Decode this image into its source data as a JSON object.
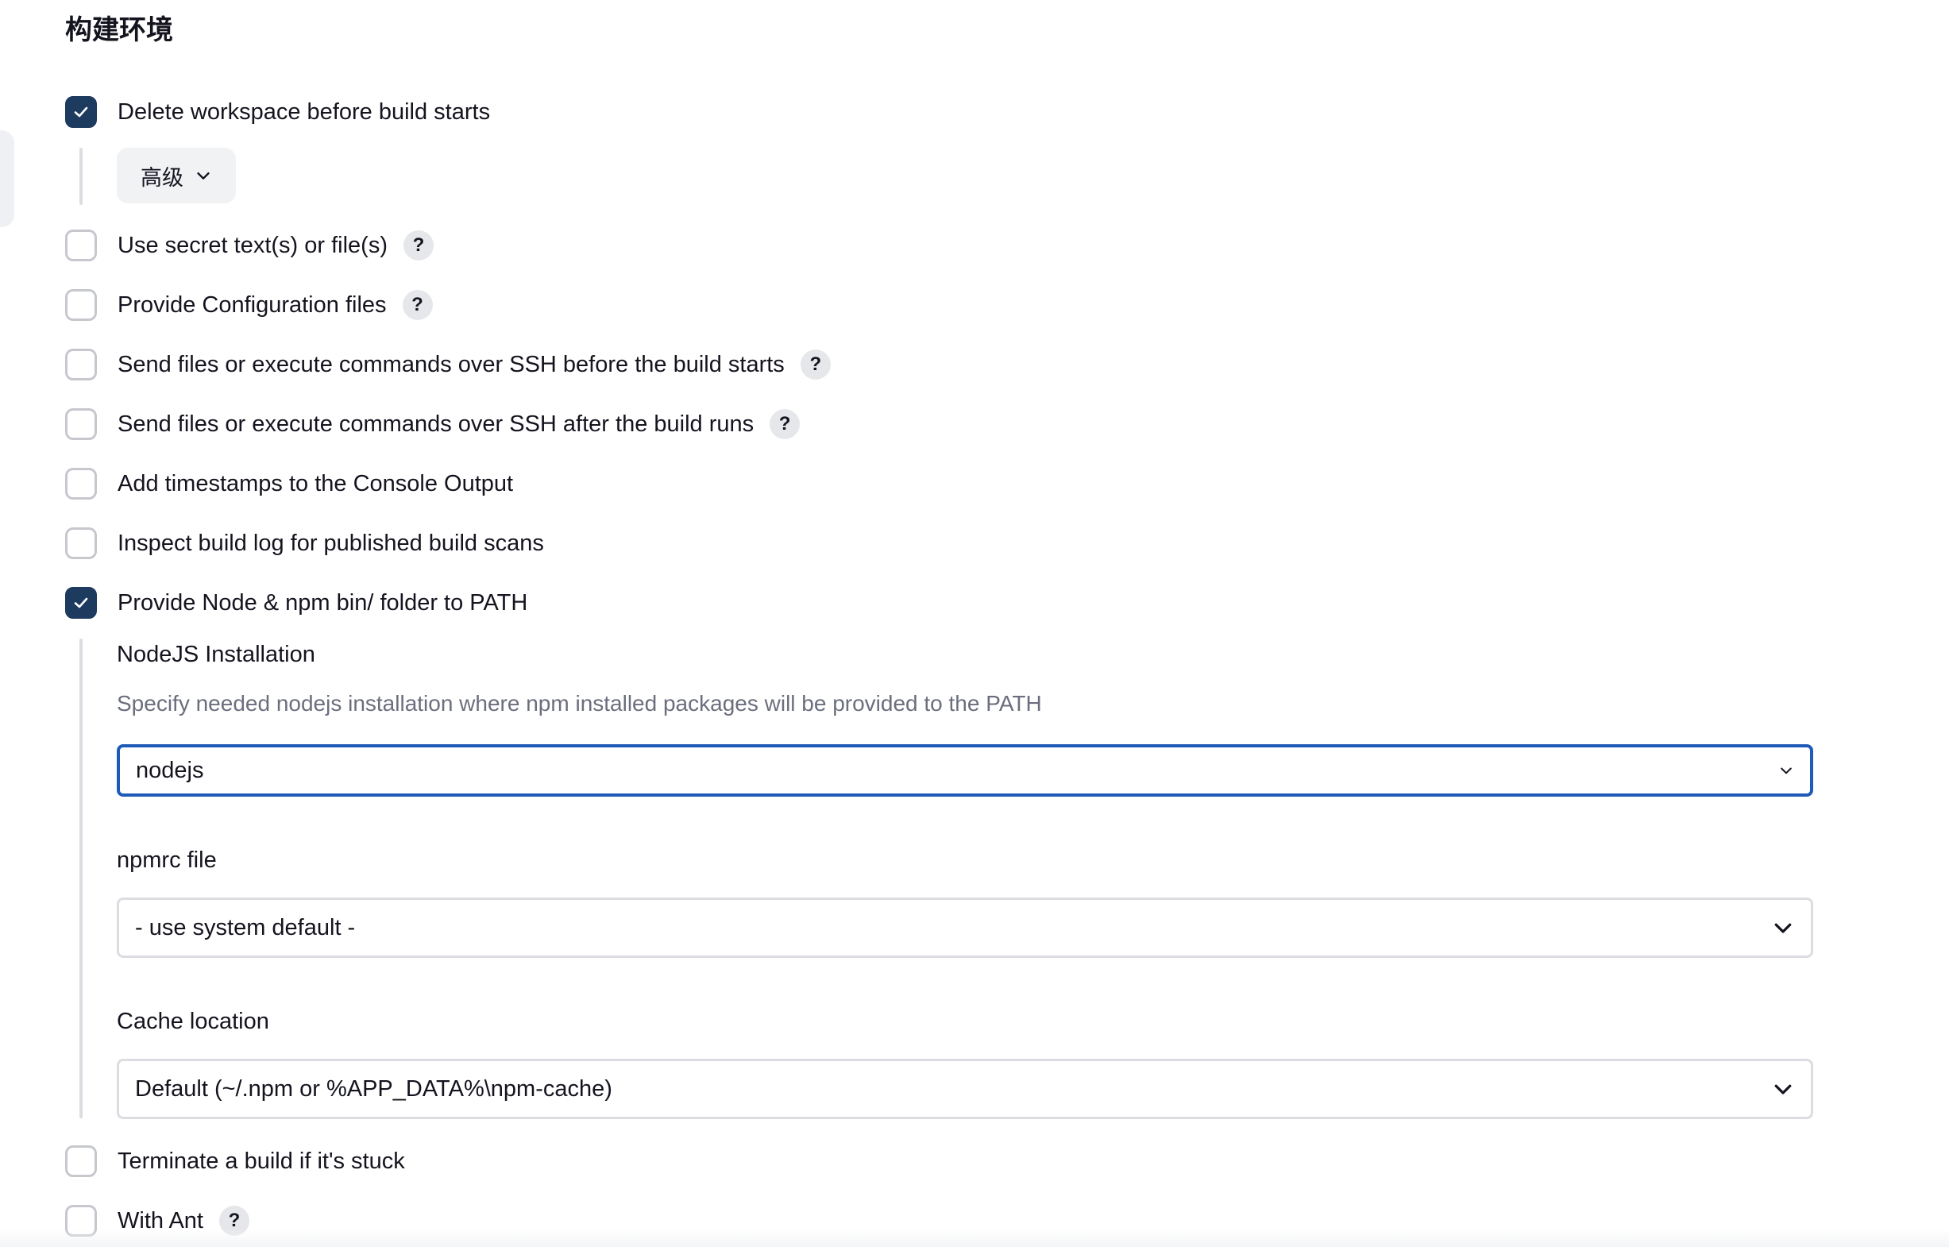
{
  "section": {
    "title": "构建环境"
  },
  "options": [
    {
      "id": "delete-workspace",
      "label": "Delete workspace before build starts",
      "checked": true,
      "has_help": false
    },
    {
      "id": "use-secret",
      "label": "Use secret text(s) or file(s)",
      "checked": false,
      "has_help": true
    },
    {
      "id": "provide-config-files",
      "label": "Provide Configuration files",
      "checked": false,
      "has_help": true
    },
    {
      "id": "ssh-before",
      "label": "Send files or execute commands over SSH before the build starts",
      "checked": false,
      "has_help": true
    },
    {
      "id": "ssh-after",
      "label": "Send files or execute commands over SSH after the build runs",
      "checked": false,
      "has_help": true
    },
    {
      "id": "timestamps",
      "label": "Add timestamps to the Console Output",
      "checked": false,
      "has_help": false
    },
    {
      "id": "inspect-build-log",
      "label": "Inspect build log for published build scans",
      "checked": false,
      "has_help": false
    },
    {
      "id": "provide-node",
      "label": "Provide Node & npm bin/ folder to PATH",
      "checked": true,
      "has_help": false
    },
    {
      "id": "terminate-stuck",
      "label": "Terminate a build if it's stuck",
      "checked": false,
      "has_help": false
    },
    {
      "id": "with-ant",
      "label": "With Ant",
      "checked": false,
      "has_help": true
    }
  ],
  "advanced": {
    "label": "高级",
    "icon": "chevron-down-icon"
  },
  "help": {
    "symbol": "?"
  },
  "node": {
    "installation": {
      "label": "NodeJS Installation",
      "description": "Specify needed nodejs installation where npm installed packages will be provided to the PATH",
      "value": "nodejs"
    },
    "npmrc": {
      "label": "npmrc file",
      "value": "- use system default -"
    },
    "cache": {
      "label": "Cache location",
      "value": "Default (~/.npm or %APP_DATA%\\npm-cache)"
    }
  },
  "colors": {
    "checkbox_checked": "#1d3a5f",
    "focus_border": "#1e5bb8",
    "description_text": "#6b6e7d"
  }
}
